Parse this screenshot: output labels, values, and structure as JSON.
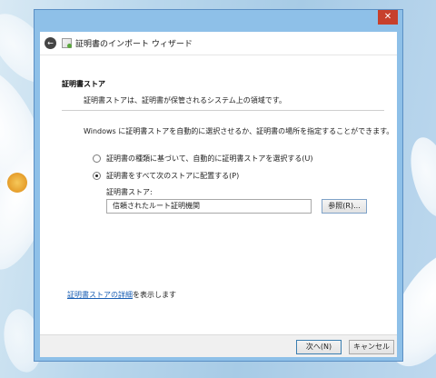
{
  "window": {
    "title": "証明書のインポート ウィザード",
    "close_glyph": "✕",
    "back_glyph": "←"
  },
  "section": {
    "heading": "証明書ストア",
    "description": "証明書ストアは、証明書が保管されるシステム上の領域です。"
  },
  "instruction": "Windows に証明書ストアを自動的に選択させるか、証明書の場所を指定することができます。",
  "options": [
    {
      "label": "証明書の種類に基づいて、自動的に証明書ストアを選択する(U)",
      "selected": false
    },
    {
      "label": "証明書をすべて次のストアに配置する(P)",
      "selected": true
    }
  ],
  "store": {
    "label": "証明書ストア:",
    "value": "信頼されたルート証明機関",
    "browse_label": "参照(R)..."
  },
  "detail": {
    "link_text": "証明書ストアの詳細",
    "suffix": "を表示します"
  },
  "footer": {
    "next_label": "次へ(N)",
    "cancel_label": "キャンセル"
  },
  "icons": {
    "back": "back-arrow-icon",
    "wizard": "certificate-wizard-icon",
    "close": "close-icon"
  }
}
